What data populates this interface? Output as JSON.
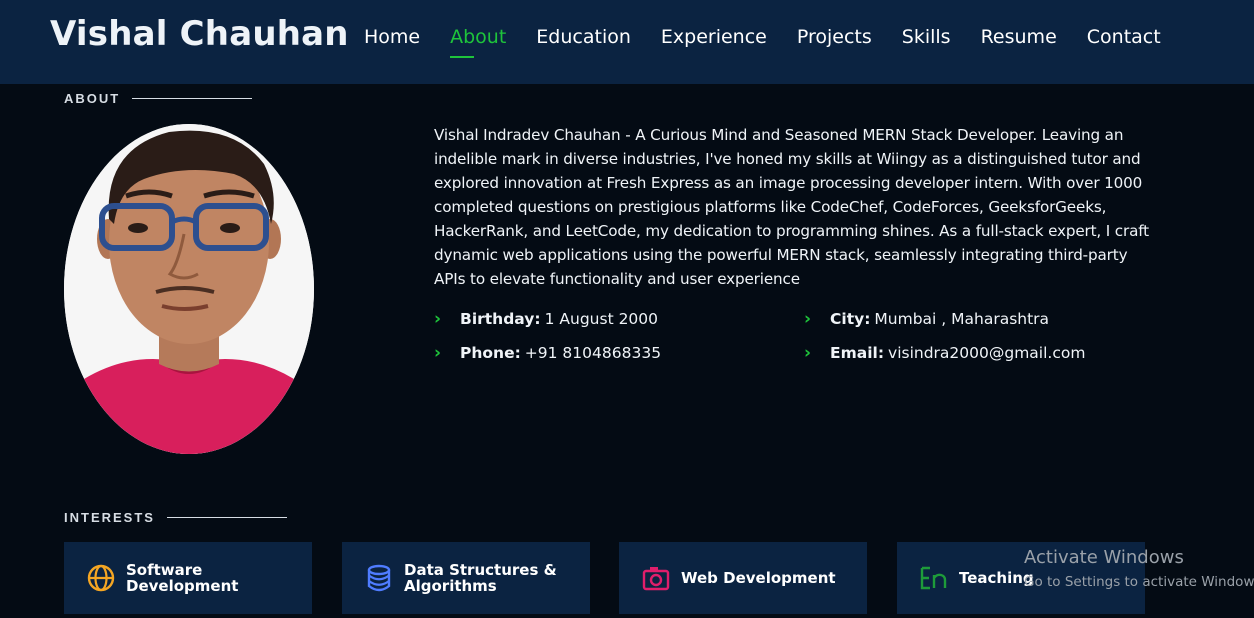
{
  "header": {
    "brand": "Vishal Chauhan",
    "nav": [
      {
        "label": "Home",
        "active": false
      },
      {
        "label": "About",
        "active": true
      },
      {
        "label": "Education",
        "active": false
      },
      {
        "label": "Experience",
        "active": false
      },
      {
        "label": "Projects",
        "active": false
      },
      {
        "label": "Skills",
        "active": false
      },
      {
        "label": "Resume",
        "active": false
      },
      {
        "label": "Contact",
        "active": false
      }
    ]
  },
  "about": {
    "title": "ABOUT",
    "bio": "Vishal Indradev Chauhan - A Curious Mind and Seasoned MERN Stack Developer. Leaving an indelible mark in diverse industries, I've honed my skills at Wiingy as a distinguished tutor and explored innovation at Fresh Express as an image processing developer intern. With over 1000 completed questions on prestigious platforms like CodeChef, CodeForces, GeeksforGeeks, HackerRank, and LeetCode, my dedication to programming shines. As a full-stack expert, I craft dynamic web applications using the powerful MERN stack, seamlessly integrating third-party APIs to elevate functionality and user experience",
    "details": {
      "birthday": {
        "label": "Birthday:",
        "value": "1 August 2000"
      },
      "city": {
        "label": "City:",
        "value": "Mumbai , Maharashtra"
      },
      "phone": {
        "label": "Phone:",
        "value": "+91 8104868335"
      },
      "email": {
        "label": "Email:",
        "value": "visindra2000@gmail.com"
      }
    }
  },
  "interests": {
    "title": "INTERESTS",
    "items": [
      {
        "label": "Software Development",
        "icon": "globe-icon",
        "color": "#f5a623"
      },
      {
        "label": "Data Structures & Algorithms",
        "icon": "database-icon",
        "color": "#4f7cff"
      },
      {
        "label": "Web Development",
        "icon": "camera-icon",
        "color": "#e01e6b"
      },
      {
        "label": "Teaching",
        "icon": "language-icon",
        "color": "#1e9b3a"
      }
    ]
  },
  "watermark": {
    "line1": "Activate Windows",
    "line2": "Go to Settings to activate Windows."
  },
  "colors": {
    "accent": "#1ec43b",
    "header_bg": "#0b2341",
    "page_bg": "#040b14"
  }
}
